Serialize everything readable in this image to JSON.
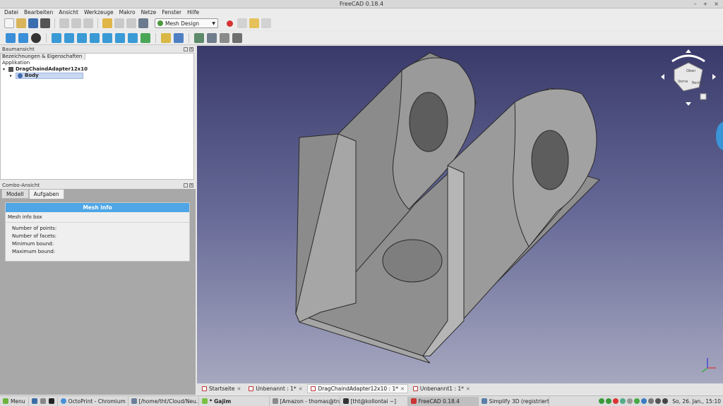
{
  "window": {
    "title": "FreeCAD 0.18.4"
  },
  "menu": [
    "Datei",
    "Bearbeiten",
    "Ansicht",
    "Werkzeuge",
    "Makro",
    "Netze",
    "Fenster",
    "Hilfe"
  ],
  "workbench": {
    "label": "Mesh Design"
  },
  "tree_panel": {
    "title": "Baumansicht",
    "header": "Bezeichnungen & Eigenschaften",
    "section": "Applikation",
    "document": "DragChaindAdapter12x10",
    "body": "Body"
  },
  "combo_panel": {
    "title": "Combo-Ansicht",
    "tabs": [
      "Modell",
      "Aufgaben"
    ],
    "active_tab": "Aufgaben",
    "mesh_info_title": "Mesh info",
    "mesh_info_box": "Mesh info box",
    "fields": [
      "Number of points:",
      "Number of facets:",
      "Minimum bound:",
      "Maximum bound:"
    ]
  },
  "nav_cube": {
    "faces": [
      "Vorne",
      "Oben",
      "Rechts"
    ]
  },
  "doc_tabs": [
    {
      "label": "Startseite",
      "active": false
    },
    {
      "label": "Unbenannt : 1*",
      "active": false
    },
    {
      "label": "DragChaindAdapter12x10 : 1*",
      "active": true
    },
    {
      "label": "Unbenannt1 : 1*",
      "active": false
    }
  ],
  "taskbar": {
    "menu": "Menu",
    "items": [
      "OctoPrint - Chromium",
      "[/home/tht/Cloud/Neu...",
      "* Gajim",
      "[Amazon - thomas@tru...",
      "[tht@kollontai ~]",
      "FreeCAD 0.18.4",
      "Simplify 3D (registriert ..."
    ],
    "clock": "So, 26. Jan., 15:10"
  },
  "colors": {
    "accent": "#4ea6e6",
    "viewport_top": "#393a6a",
    "viewport_bottom": "#a6a8c0",
    "model": "#9a9a9a"
  }
}
